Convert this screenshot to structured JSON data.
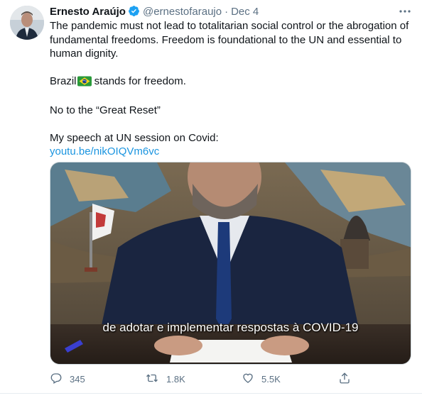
{
  "author": {
    "name": "Ernesto Araújo",
    "handle": "@ernestofaraujo",
    "separator": "·",
    "date": "Dec 4"
  },
  "tweet": {
    "paragraph1": "The pandemic must not lead to totalitarian social control or the abrogation of fundamental freedoms. Freedom is foundational to the UN and essential to human dignity.",
    "paragraph2_text": "Brazil",
    "paragraph2_emoji": "brazil-flag-icon",
    "paragraph2_rest": " stands for freedom.",
    "paragraph3": "No to the “Great Reset”",
    "paragraph4": "My speech at UN session on Covid:",
    "link": "youtu.be/nikOIQVm6vc"
  },
  "media": {
    "caption": "de adotar e implementar respostas à COVID-19"
  },
  "actions": {
    "reply_count": "345",
    "retweet_count": "1.8K",
    "like_count": "5.5K"
  },
  "colors": {
    "accent": "#1b95e0",
    "secondary_text": "#5b7083",
    "verified": "#1da1f2"
  }
}
